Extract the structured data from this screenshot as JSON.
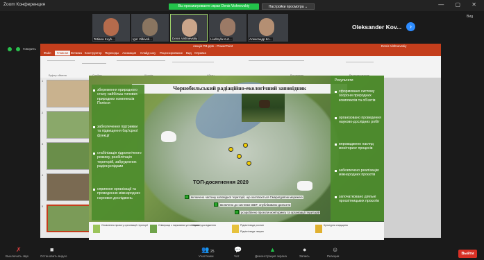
{
  "window": {
    "app_title": "Zoom Конференция",
    "share_banner": "Вы просматриваете экран Denis Vishnevskiy",
    "view_options": "Настройки просмотра ⌄",
    "controls": "— ▢ ✕"
  },
  "gallery": {
    "participants": [
      {
        "name": "Tetiana Kuyb..."
      },
      {
        "name": "Igor Vitkivsk..."
      },
      {
        "name": "Denis Vishnevskiy"
      },
      {
        "name": "Liudmyla Kuz..."
      },
      {
        "name": "Александр Ко..."
      }
    ],
    "active_speaker": "Oleksander Kov...",
    "view_toggle": "Вид"
  },
  "status": {
    "speaker_label": "Говорить"
  },
  "powerpoint": {
    "title": "лекція ПЗ.pptx - PowerPoint",
    "user": "Denis Vishnevskiy",
    "tabs": [
      "Файл",
      "Главная",
      "Вставка",
      "Конструктор",
      "Переходы",
      "Анимация",
      "Слайд-шоу",
      "Рецензирование",
      "Вид",
      "Справка"
    ],
    "active_tab": "Главная",
    "ribbon_groups": [
      "Буфер обмена",
      "Слайды",
      "Шрифт",
      "Абзац",
      "Рисование",
      "Редактирование"
    ]
  },
  "slide": {
    "title": "Чорнобильський радіаційно-екологічний заповідник",
    "left_items": [
      "збереження природного стану найбільш типових природних комплексів Полісся",
      "забезпечення підтримки та підвищення бар'єрної функції",
      "стабілізація гідрологічного режиму, реабілітація територій, забруднених радіонуклідами",
      "сприяння організації та проведенню міжнародних наукових досліджень"
    ],
    "right_header": "Результати",
    "right_items": [
      "сформовано систему охорони природних комплексів та об'єктів",
      "організовано проведення науково-дослідних робіт",
      "впроваджено нагляд моніторинг процесів",
      "забезпечено реалізацію міжнародних проєктів",
      "започатковано діяльні просвітницьких проєктів"
    ],
    "achievements_label": "ТОП-досягнення 2020",
    "achievements": [
      "включено частину заповідної території, що охоплюється Смарагдовою мережею",
      "включено до системи GBIF, опубліковано датасети",
      "розроблено проєкти моніторингу та організації територій"
    ],
    "footer_items": [
      "Оновлення проєкту організації території",
      "Співпраця з науковими установами",
      "Наукові дослідження",
      "Рідкісні види рослин",
      "Рідкісні види тварин",
      "Культурна спадщина"
    ]
  },
  "toolbar": {
    "mute": "Выключить звук",
    "video": "Остановить видео",
    "participants": "Участники",
    "participants_count": "25",
    "chat": "Чат",
    "share": "Демонстрация экрана",
    "record": "Запись",
    "reactions": "Реакции",
    "leave": "Выйти"
  },
  "colors": {
    "accent_green": "#23c34a",
    "ppt_red": "#c43e1c",
    "slide_green": "#4d8c2d",
    "leave_red": "#d93025"
  }
}
